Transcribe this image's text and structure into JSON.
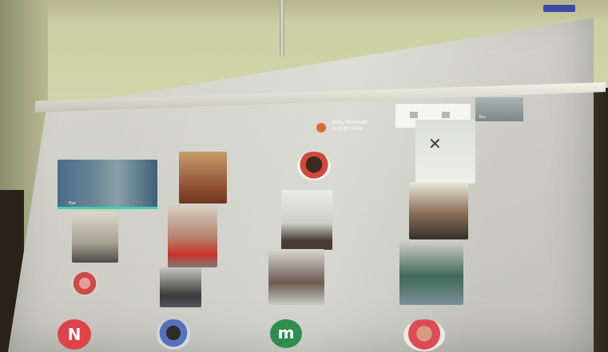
{
  "meeting": {
    "notice_text": "Baby Hiremath\nand 20 more",
    "top_panel": {
      "icons": [
        "camera-icon",
        "share-icon"
      ]
    },
    "self_view_label": "You"
  },
  "participants": {
    "tile1_label": "Ese",
    "letter_avatars": [
      "N",
      "m"
    ]
  },
  "colors": {
    "screen": "#d2d2cc",
    "wall": "#cdd0a8",
    "speaking_bar": "#3fd1a6",
    "avatar_n": "#e0424a",
    "avatar_m": "#2f8d4d",
    "notice_dot": "#d96b3b"
  }
}
